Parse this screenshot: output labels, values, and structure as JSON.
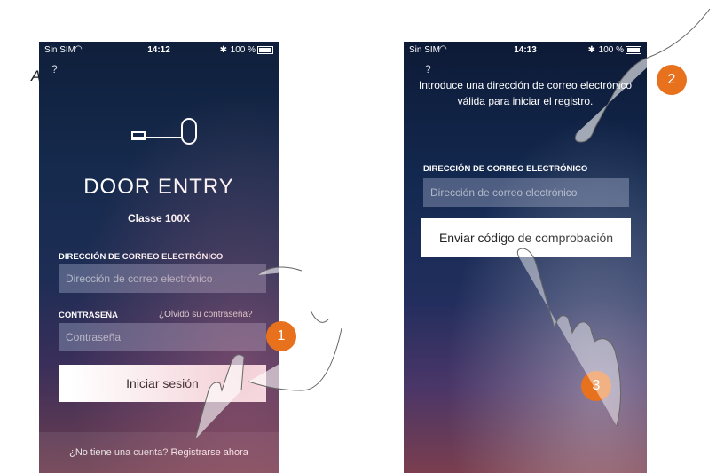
{
  "callout": {
    "label": "A"
  },
  "badges": [
    "1",
    "2",
    "3"
  ],
  "phone1": {
    "status": {
      "carrier": "Sin SIM",
      "time": "14:12",
      "battery": "100 %"
    },
    "help": "?",
    "title": "DOOR ENTRY",
    "subtitle": "Classe 100X",
    "email_label": "DIRECCIÓN DE CORREO ELECTRÓNICO",
    "email_placeholder": "Dirección de correo electrónico",
    "password_label": "CONTRASEÑA",
    "forgot": "¿Olvidó su contraseña?",
    "password_placeholder": "Contraseña",
    "login_button": "Iniciar sesión",
    "no_account": "¿No tiene una cuenta?",
    "register": "Registrarse ahora"
  },
  "phone2": {
    "status": {
      "carrier": "Sin SIM",
      "time": "14:13",
      "battery": "100 %"
    },
    "help": "?",
    "intro": "Introduce una dirección de correo electrónico válida para iniciar el registro.",
    "email_label": "DIRECCIÓN DE CORREO ELECTRÓNICO",
    "email_placeholder": "Dirección de correo electrónico",
    "send_button": "Enviar código de comprobación"
  },
  "icons": [
    "key-icon",
    "wifi-icon",
    "bluetooth-icon",
    "battery-icon",
    "hand-pointer-icon"
  ]
}
